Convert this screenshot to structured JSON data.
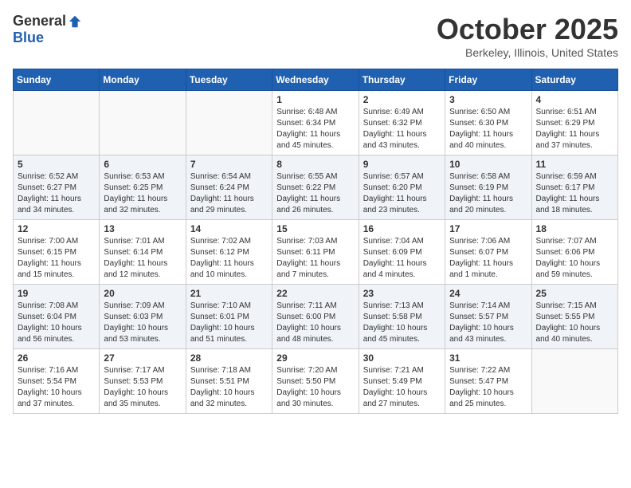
{
  "logo": {
    "general": "General",
    "blue": "Blue"
  },
  "title": "October 2025",
  "location": "Berkeley, Illinois, United States",
  "days_of_week": [
    "Sunday",
    "Monday",
    "Tuesday",
    "Wednesday",
    "Thursday",
    "Friday",
    "Saturday"
  ],
  "weeks": [
    [
      {
        "day": "",
        "info": ""
      },
      {
        "day": "",
        "info": ""
      },
      {
        "day": "",
        "info": ""
      },
      {
        "day": "1",
        "info": "Sunrise: 6:48 AM\nSunset: 6:34 PM\nDaylight: 11 hours and 45 minutes."
      },
      {
        "day": "2",
        "info": "Sunrise: 6:49 AM\nSunset: 6:32 PM\nDaylight: 11 hours and 43 minutes."
      },
      {
        "day": "3",
        "info": "Sunrise: 6:50 AM\nSunset: 6:30 PM\nDaylight: 11 hours and 40 minutes."
      },
      {
        "day": "4",
        "info": "Sunrise: 6:51 AM\nSunset: 6:29 PM\nDaylight: 11 hours and 37 minutes."
      }
    ],
    [
      {
        "day": "5",
        "info": "Sunrise: 6:52 AM\nSunset: 6:27 PM\nDaylight: 11 hours and 34 minutes."
      },
      {
        "day": "6",
        "info": "Sunrise: 6:53 AM\nSunset: 6:25 PM\nDaylight: 11 hours and 32 minutes."
      },
      {
        "day": "7",
        "info": "Sunrise: 6:54 AM\nSunset: 6:24 PM\nDaylight: 11 hours and 29 minutes."
      },
      {
        "day": "8",
        "info": "Sunrise: 6:55 AM\nSunset: 6:22 PM\nDaylight: 11 hours and 26 minutes."
      },
      {
        "day": "9",
        "info": "Sunrise: 6:57 AM\nSunset: 6:20 PM\nDaylight: 11 hours and 23 minutes."
      },
      {
        "day": "10",
        "info": "Sunrise: 6:58 AM\nSunset: 6:19 PM\nDaylight: 11 hours and 20 minutes."
      },
      {
        "day": "11",
        "info": "Sunrise: 6:59 AM\nSunset: 6:17 PM\nDaylight: 11 hours and 18 minutes."
      }
    ],
    [
      {
        "day": "12",
        "info": "Sunrise: 7:00 AM\nSunset: 6:15 PM\nDaylight: 11 hours and 15 minutes."
      },
      {
        "day": "13",
        "info": "Sunrise: 7:01 AM\nSunset: 6:14 PM\nDaylight: 11 hours and 12 minutes."
      },
      {
        "day": "14",
        "info": "Sunrise: 7:02 AM\nSunset: 6:12 PM\nDaylight: 11 hours and 10 minutes."
      },
      {
        "day": "15",
        "info": "Sunrise: 7:03 AM\nSunset: 6:11 PM\nDaylight: 11 hours and 7 minutes."
      },
      {
        "day": "16",
        "info": "Sunrise: 7:04 AM\nSunset: 6:09 PM\nDaylight: 11 hours and 4 minutes."
      },
      {
        "day": "17",
        "info": "Sunrise: 7:06 AM\nSunset: 6:07 PM\nDaylight: 11 hours and 1 minute."
      },
      {
        "day": "18",
        "info": "Sunrise: 7:07 AM\nSunset: 6:06 PM\nDaylight: 10 hours and 59 minutes."
      }
    ],
    [
      {
        "day": "19",
        "info": "Sunrise: 7:08 AM\nSunset: 6:04 PM\nDaylight: 10 hours and 56 minutes."
      },
      {
        "day": "20",
        "info": "Sunrise: 7:09 AM\nSunset: 6:03 PM\nDaylight: 10 hours and 53 minutes."
      },
      {
        "day": "21",
        "info": "Sunrise: 7:10 AM\nSunset: 6:01 PM\nDaylight: 10 hours and 51 minutes."
      },
      {
        "day": "22",
        "info": "Sunrise: 7:11 AM\nSunset: 6:00 PM\nDaylight: 10 hours and 48 minutes."
      },
      {
        "day": "23",
        "info": "Sunrise: 7:13 AM\nSunset: 5:58 PM\nDaylight: 10 hours and 45 minutes."
      },
      {
        "day": "24",
        "info": "Sunrise: 7:14 AM\nSunset: 5:57 PM\nDaylight: 10 hours and 43 minutes."
      },
      {
        "day": "25",
        "info": "Sunrise: 7:15 AM\nSunset: 5:55 PM\nDaylight: 10 hours and 40 minutes."
      }
    ],
    [
      {
        "day": "26",
        "info": "Sunrise: 7:16 AM\nSunset: 5:54 PM\nDaylight: 10 hours and 37 minutes."
      },
      {
        "day": "27",
        "info": "Sunrise: 7:17 AM\nSunset: 5:53 PM\nDaylight: 10 hours and 35 minutes."
      },
      {
        "day": "28",
        "info": "Sunrise: 7:18 AM\nSunset: 5:51 PM\nDaylight: 10 hours and 32 minutes."
      },
      {
        "day": "29",
        "info": "Sunrise: 7:20 AM\nSunset: 5:50 PM\nDaylight: 10 hours and 30 minutes."
      },
      {
        "day": "30",
        "info": "Sunrise: 7:21 AM\nSunset: 5:49 PM\nDaylight: 10 hours and 27 minutes."
      },
      {
        "day": "31",
        "info": "Sunrise: 7:22 AM\nSunset: 5:47 PM\nDaylight: 10 hours and 25 minutes."
      },
      {
        "day": "",
        "info": ""
      }
    ]
  ]
}
